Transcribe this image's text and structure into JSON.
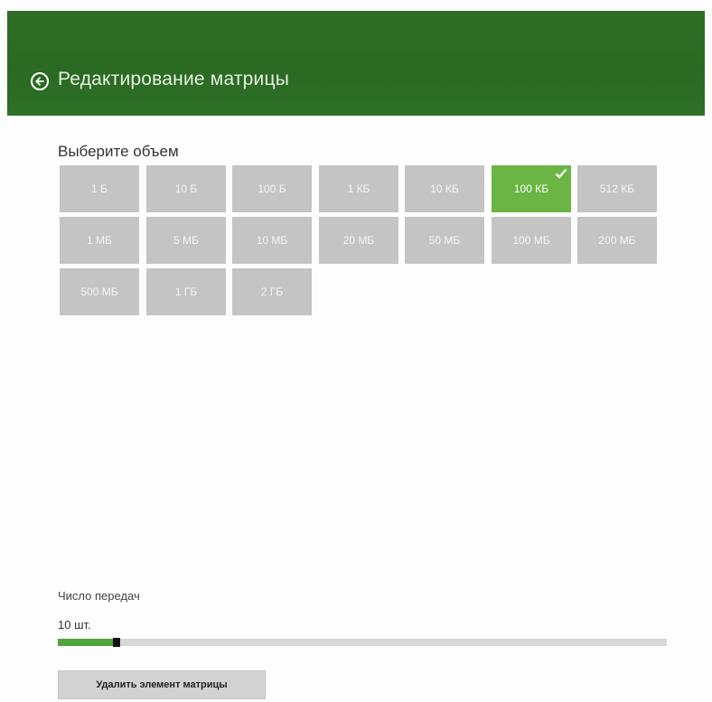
{
  "header": {
    "title": "Редактирование матрицы",
    "back_icon": "back-arrow-circle-icon",
    "background_color": "#2c6b24"
  },
  "volume": {
    "label": "Выберите объем",
    "selected": "100 КБ",
    "tiles": [
      "1 Б",
      "10 Б",
      "100 Б",
      "1 КБ",
      "10 КБ",
      "100 КБ",
      "512 КБ",
      "1 МБ",
      "5 МБ",
      "10 МБ",
      "20 МБ",
      "50 МБ",
      "100 МБ",
      "200 МБ",
      "500 МБ",
      "1 ГБ",
      "2 ГБ"
    ],
    "tile_color": "#c4c4c4",
    "selected_color": "#6ab544"
  },
  "transfers": {
    "label": "Число передач",
    "value_text": "10 шт.",
    "slider_fraction": 0.09,
    "fill_color": "#4fa53a"
  },
  "actions": {
    "delete_label": "Удалить элемент матрицы"
  }
}
